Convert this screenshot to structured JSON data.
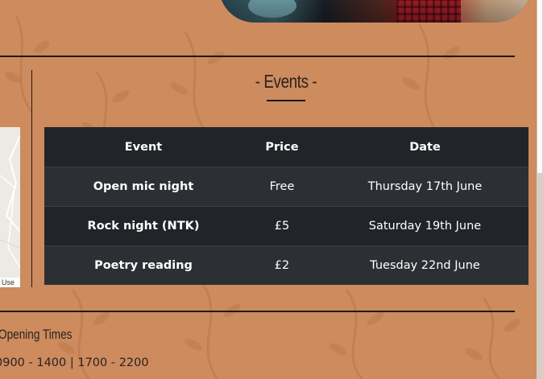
{
  "events": {
    "title": "- Events -",
    "columns": [
      "Event",
      "Price",
      "Date"
    ],
    "rows": [
      {
        "event": "Open mic night",
        "price": "Free",
        "date": "Thursday 17th June"
      },
      {
        "event": "Rock night (NTK)",
        "price": "£5",
        "date": "Saturday 19th June"
      },
      {
        "event": "Poetry reading",
        "price": "£2",
        "date": "Tuesday 22nd June"
      }
    ]
  },
  "map": {
    "use_label": "Use"
  },
  "opening": {
    "title": "Opening Times",
    "hours": "0900 - 1400 | 1700 - 2200"
  },
  "colors": {
    "background": "#cd8b5e",
    "table_dark": "#212529",
    "table_stripe": "#2c3034"
  }
}
